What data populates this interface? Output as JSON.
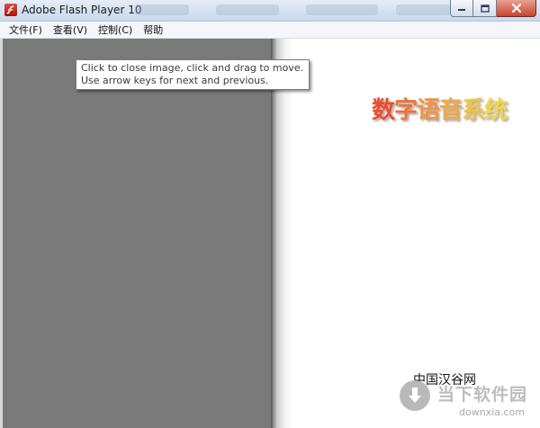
{
  "window": {
    "title": "Adobe Flash Player 10",
    "icon": "flash-player-icon",
    "buttons": [
      "minimize-icon",
      "maximize-icon",
      "close-icon"
    ]
  },
  "menu": {
    "items": [
      "文件(F)",
      "查看(V)",
      "控制(C)",
      "帮助"
    ]
  },
  "tooltip": {
    "text": "Click to close image, click and drag to move. Use arrow keys for next and previous."
  },
  "page": {
    "title_chars": [
      "数",
      "字",
      "语",
      "音",
      "系",
      "统"
    ],
    "title_colors": [
      "#ee4d2c",
      "#f07334",
      "#f39240",
      "#f2a842",
      "#f5c245",
      "#f2d64b"
    ],
    "publisher": "中国汉谷网"
  },
  "watermark": {
    "name": "当下软件园",
    "domain": "downxia.com",
    "icon": "download-arrow-icon"
  }
}
